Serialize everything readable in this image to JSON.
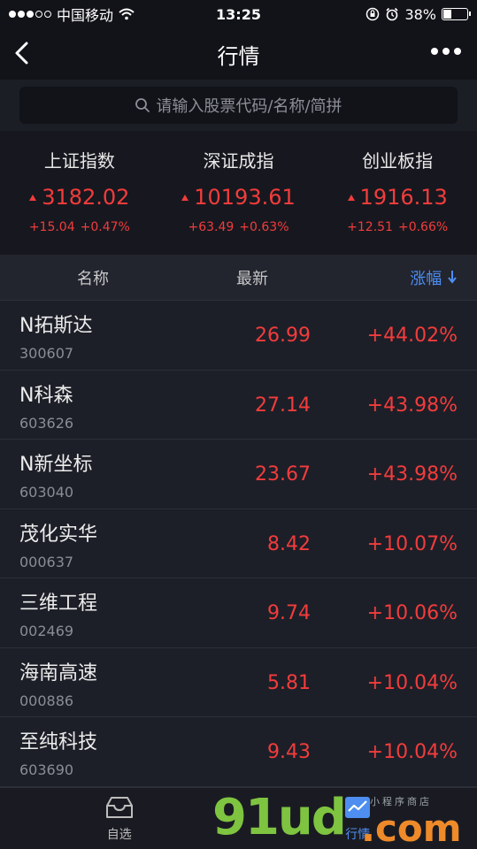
{
  "status": {
    "carrier": "中国移动",
    "time": "13:25",
    "battery": "38%"
  },
  "nav": {
    "title": "行情"
  },
  "search": {
    "placeholder": "请输入股票代码/名称/简拼"
  },
  "indices": [
    {
      "name": "上证指数",
      "value": "3182.02",
      "change": "+15.04",
      "percent": "+0.47%"
    },
    {
      "name": "深证成指",
      "value": "10193.61",
      "change": "+63.49",
      "percent": "+0.63%"
    },
    {
      "name": "创业板指",
      "value": "1916.13",
      "change": "+12.51",
      "percent": "+0.66%"
    }
  ],
  "table": {
    "col_name": "名称",
    "col_price": "最新",
    "col_change": "涨幅"
  },
  "stocks": [
    {
      "name": "N拓斯达",
      "code": "300607",
      "price": "26.99",
      "change": "+44.02%"
    },
    {
      "name": "N科森",
      "code": "603626",
      "price": "27.14",
      "change": "+43.98%"
    },
    {
      "name": "N新坐标",
      "code": "603040",
      "price": "23.67",
      "change": "+43.98%"
    },
    {
      "name": "茂化实华",
      "code": "000637",
      "price": "8.42",
      "change": "+10.07%"
    },
    {
      "name": "三维工程",
      "code": "002469",
      "price": "9.74",
      "change": "+10.06%"
    },
    {
      "name": "海南高速",
      "code": "000886",
      "price": "5.81",
      "change": "+10.04%"
    },
    {
      "name": "至纯科技",
      "code": "603690",
      "price": "9.43",
      "change": "+10.04%"
    }
  ],
  "tabs": {
    "watchlist": "自选",
    "market": "行情"
  },
  "watermark": {
    "brand": "91ud",
    "domain": ".com",
    "tagline": "小程序商店"
  },
  "colors": {
    "up": "#f23c3c",
    "accent": "#4d8ef0"
  }
}
